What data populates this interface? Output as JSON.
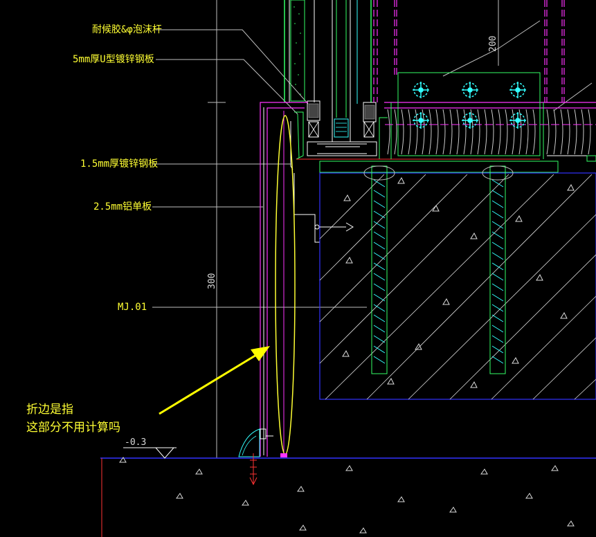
{
  "labels": {
    "l1": "耐候胶&φ泡沫杆",
    "l2": "5mm厚U型镀锌钢板",
    "l3": "1.5mm厚镀锌钢板",
    "l4": "2.5mm铝单板",
    "l5": "MJ.01"
  },
  "dimensions": {
    "d200": "200",
    "d300": "300",
    "level": "-0.3"
  },
  "note": {
    "line1": "折边是指",
    "line2": "这部分不用计算吗"
  },
  "colors": {
    "background": "#000000",
    "label": "#ffff33",
    "magenta": "#ff33ff",
    "cyan": "#33ffff",
    "green": "#33ff66",
    "blue": "#3333ff",
    "white": "#ffffff",
    "red": "#ff3333",
    "arrow": "#ffff00"
  }
}
